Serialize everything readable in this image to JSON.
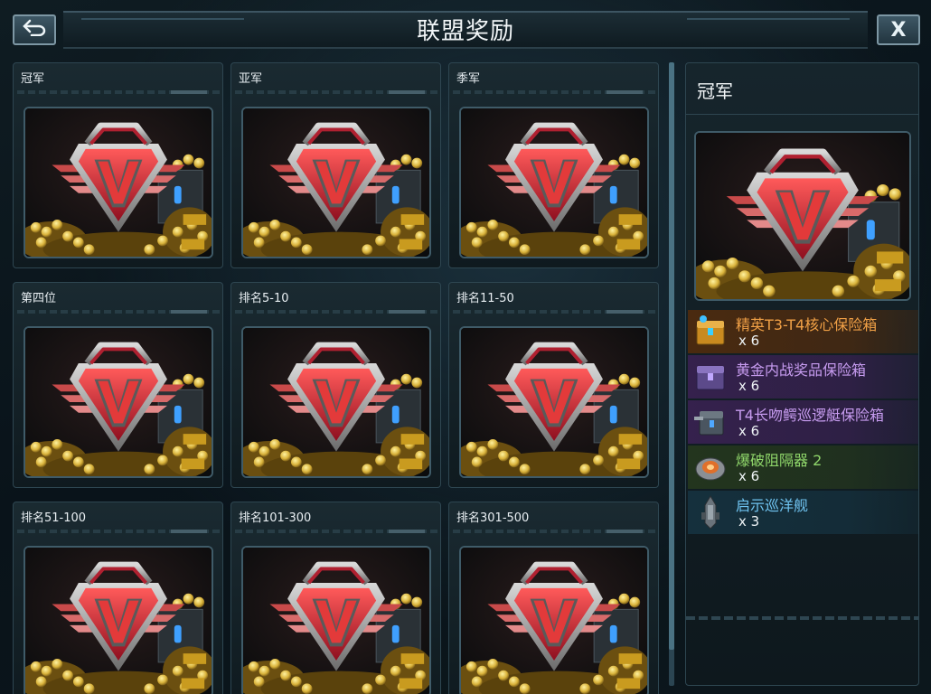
{
  "header": {
    "title": "联盟奖励",
    "back_icon": "back-arrow-icon",
    "close_label": "X"
  },
  "cards": [
    {
      "label": "冠军"
    },
    {
      "label": "亚军"
    },
    {
      "label": "季军"
    },
    {
      "label": "第四位"
    },
    {
      "label": "排名5-10"
    },
    {
      "label": "排名11-50"
    },
    {
      "label": "排名51-100"
    },
    {
      "label": "排名101-300"
    },
    {
      "label": "排名301-500"
    }
  ],
  "detail": {
    "title": "冠军",
    "items": [
      {
        "name": "精英T3-T4核心保险箱",
        "qty": "x 6",
        "color": "#f0a046",
        "bg": "#4a2a10",
        "icon": "gold-crate-icon"
      },
      {
        "name": "黄金内战奖品保险箱",
        "qty": "x 6",
        "color": "#c79cf0",
        "bg": "#35214d",
        "icon": "purple-crate-icon"
      },
      {
        "name": "T4长吻鳄巡逻艇保险箱",
        "qty": "x 6",
        "color": "#c79cf0",
        "bg": "#35214d",
        "icon": "patrol-boat-crate-icon"
      },
      {
        "name": "爆破阻隔器 2",
        "qty": "x 6",
        "color": "#8fd66a",
        "bg": "#23351e",
        "icon": "blast-barrier-icon"
      },
      {
        "name": "启示巡洋舰",
        "qty": "x 3",
        "color": "#6fc3f0",
        "bg": "#15303d",
        "icon": "cruiser-ship-icon"
      }
    ]
  },
  "colors": {
    "accent": "#3f5b68",
    "emblem_red": "#c8283a",
    "gold": "#d9b23a"
  }
}
